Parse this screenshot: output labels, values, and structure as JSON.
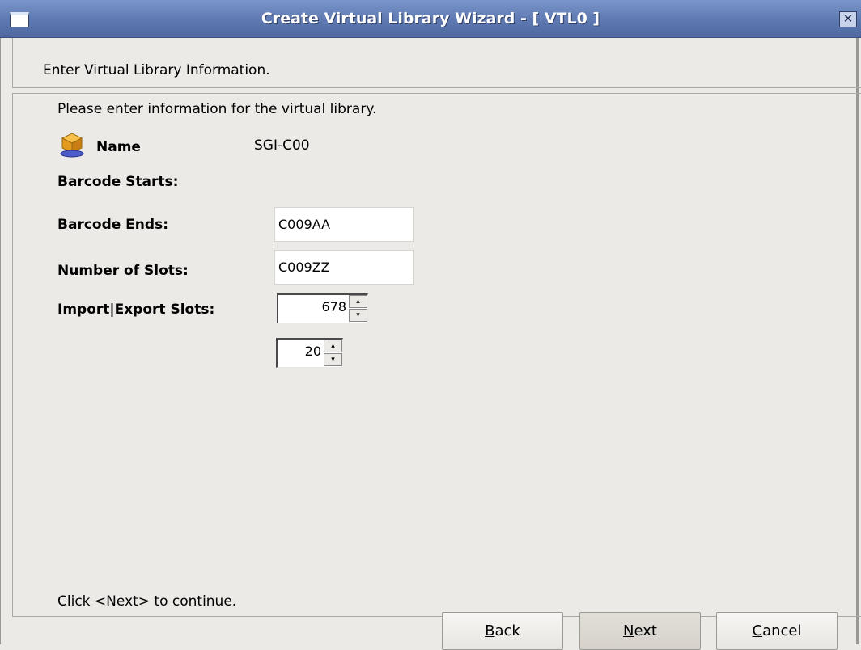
{
  "window": {
    "title": "Create Virtual Library Wizard - [ VTL0 ]"
  },
  "header": {
    "instruction": "Enter Virtual Library Information."
  },
  "form": {
    "intro": "Please enter information for the virtual library.",
    "name_label": "Name",
    "name_value": "SGI-C00",
    "barcode_starts_label": "Barcode Starts:",
    "barcode_starts_value": "C009AA",
    "barcode_ends_label": "Barcode Ends:",
    "barcode_ends_value": "C009ZZ",
    "slots_label": "Number of Slots:",
    "slots_value": "678",
    "import_export_label": "Import|Export Slots:",
    "import_export_value": "20",
    "footer_hint": "Click <Next> to continue."
  },
  "buttons": {
    "back_rest": "ack",
    "back_mnemonic": "B",
    "next_rest": "ext",
    "next_mnemonic": "N",
    "cancel_rest": "ancel",
    "cancel_mnemonic": "C"
  },
  "icons": {
    "library": "library-icon",
    "close": "close-icon",
    "window_menu": "window-menu-icon",
    "spin_up": "spin-up-icon",
    "spin_down": "spin-down-icon"
  }
}
